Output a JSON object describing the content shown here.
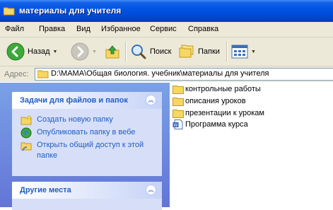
{
  "window": {
    "title": "материалы для учителя"
  },
  "menu": {
    "items": [
      "Файл",
      "Правка",
      "Вид",
      "Избранное",
      "Сервис",
      "Справка"
    ]
  },
  "toolbar": {
    "back_label": "Назад",
    "search_label": "Поиск",
    "folders_label": "Папки"
  },
  "address": {
    "label": "Адрес:",
    "value": "D:\\МАМА\\Общая биология. учебник\\материалы для учителя"
  },
  "tasks_panel": {
    "title": "Задачи для файлов и папок",
    "items": [
      {
        "label": "Создать новую папку",
        "icon": "new-folder-icon"
      },
      {
        "label": "Опубликовать папку в вебе",
        "icon": "publish-web-icon"
      },
      {
        "label": "Открыть общий доступ к этой папке",
        "icon": "share-folder-icon"
      }
    ]
  },
  "other_places_panel": {
    "title": "Другие места"
  },
  "files": [
    {
      "name": "контрольные работы",
      "type": "folder"
    },
    {
      "name": "описания уроков",
      "type": "folder"
    },
    {
      "name": "презентации к урокам",
      "type": "folder"
    },
    {
      "name": "Программа курса",
      "type": "document"
    }
  ],
  "colors": {
    "titlebar": "#0055e5",
    "task_link": "#215dc6",
    "left_pane": "#7aa1e6"
  }
}
